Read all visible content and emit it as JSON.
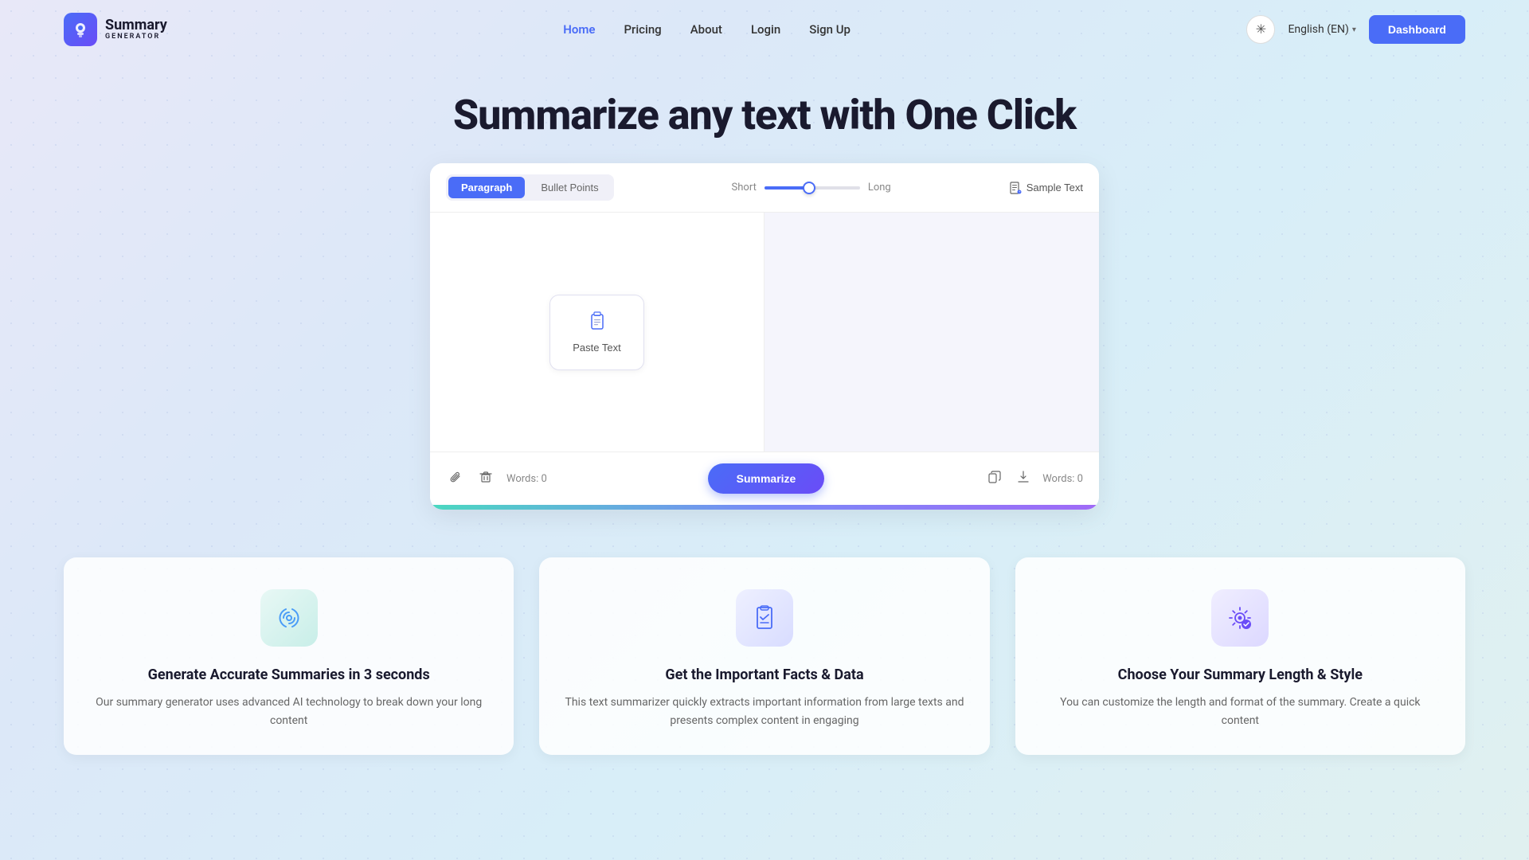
{
  "navbar": {
    "logo_title": "Summary",
    "logo_subtitle": "GENERATOR",
    "nav_links": [
      {
        "label": "Home",
        "active": true
      },
      {
        "label": "Pricing",
        "active": false
      },
      {
        "label": "About",
        "active": false
      },
      {
        "label": "Login",
        "active": false
      },
      {
        "label": "Sign Up",
        "active": false
      }
    ],
    "language": "English (EN)",
    "dashboard_label": "Dashboard"
  },
  "hero": {
    "title": "Summarize any text with One Click"
  },
  "summarizer": {
    "format_tabs": [
      {
        "label": "Paragraph",
        "active": true
      },
      {
        "label": "Bullet Points",
        "active": false
      }
    ],
    "slider_short_label": "Short",
    "slider_long_label": "Long",
    "sample_text_label": "Sample Text",
    "paste_text_label": "Paste Text",
    "input_word_count": "Words: 0",
    "output_word_count": "Words: 0",
    "summarize_label": "Summarize"
  },
  "features": [
    {
      "icon_name": "fingerprint-icon",
      "icon_type": "teal",
      "title": "Generate Accurate Summaries in 3 seconds",
      "desc": "Our summary generator uses advanced AI technology to break down your long content"
    },
    {
      "icon_name": "clipboard-check-icon",
      "icon_type": "blue",
      "title": "Get the Important Facts & Data",
      "desc": "This text summarizer quickly extracts important information from large texts and presents complex content in engaging"
    },
    {
      "icon_name": "gear-badge-icon",
      "icon_type": "purple",
      "title": "Choose Your Summary Length & Style",
      "desc": "You can customize the length and format of the summary. Create a quick content"
    }
  ]
}
